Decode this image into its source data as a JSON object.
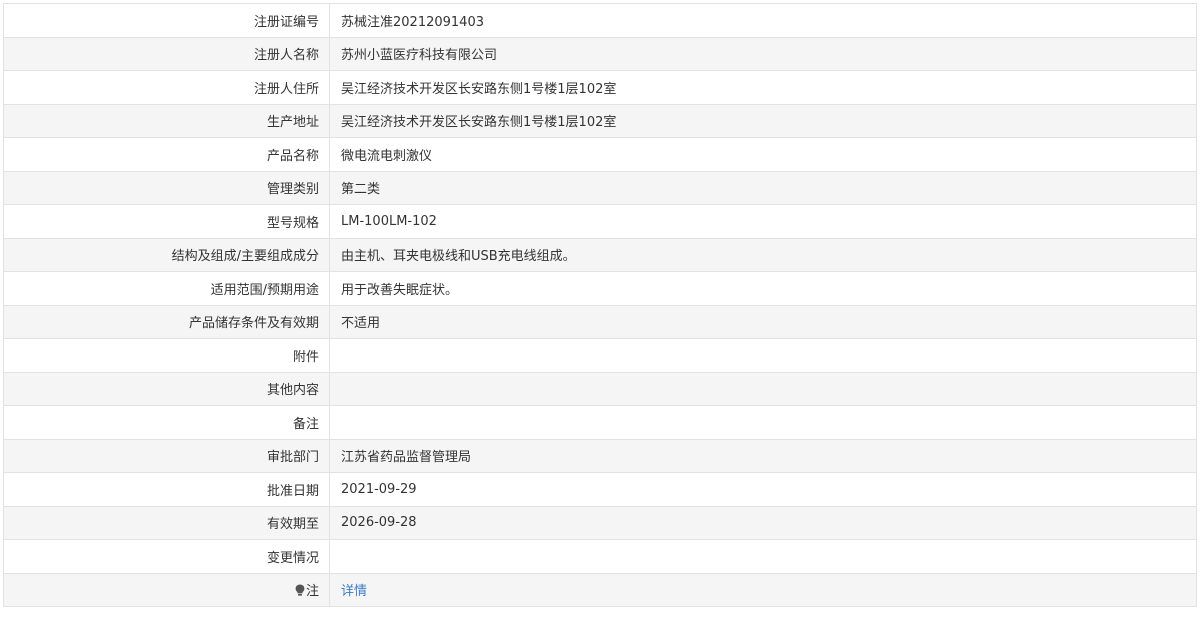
{
  "record": {
    "rows": [
      {
        "label": "注册证编号",
        "value": "苏械注准20212091403"
      },
      {
        "label": "注册人名称",
        "value": "苏州小蓝医疗科技有限公司"
      },
      {
        "label": "注册人住所",
        "value": "吴江经济技术开发区长安路东侧1号楼1层102室"
      },
      {
        "label": "生产地址",
        "value": "吴江经济技术开发区长安路东侧1号楼1层102室"
      },
      {
        "label": "产品名称",
        "value": "微电流电刺激仪"
      },
      {
        "label": "管理类别",
        "value": "第二类"
      },
      {
        "label": "型号规格",
        "value": "LM-100LM-102"
      },
      {
        "label": "结构及组成/主要组成成分",
        "value": "由主机、耳夹电极线和USB充电线组成。"
      },
      {
        "label": "适用范围/预期用途",
        "value": "用于改善失眠症状。"
      },
      {
        "label": "产品储存条件及有效期",
        "value": "不适用"
      },
      {
        "label": "附件",
        "value": ""
      },
      {
        "label": "其他内容",
        "value": ""
      },
      {
        "label": "备注",
        "value": ""
      },
      {
        "label": "审批部门",
        "value": "江苏省药品监督管理局"
      },
      {
        "label": "批准日期",
        "value": "2021-09-29"
      },
      {
        "label": "有效期至",
        "value": "2026-09-28"
      },
      {
        "label": "变更情况",
        "value": ""
      }
    ],
    "note": {
      "icon": "bulb-icon",
      "label": "注",
      "link_text": "详情",
      "link_color": "#3a7cc8"
    }
  }
}
